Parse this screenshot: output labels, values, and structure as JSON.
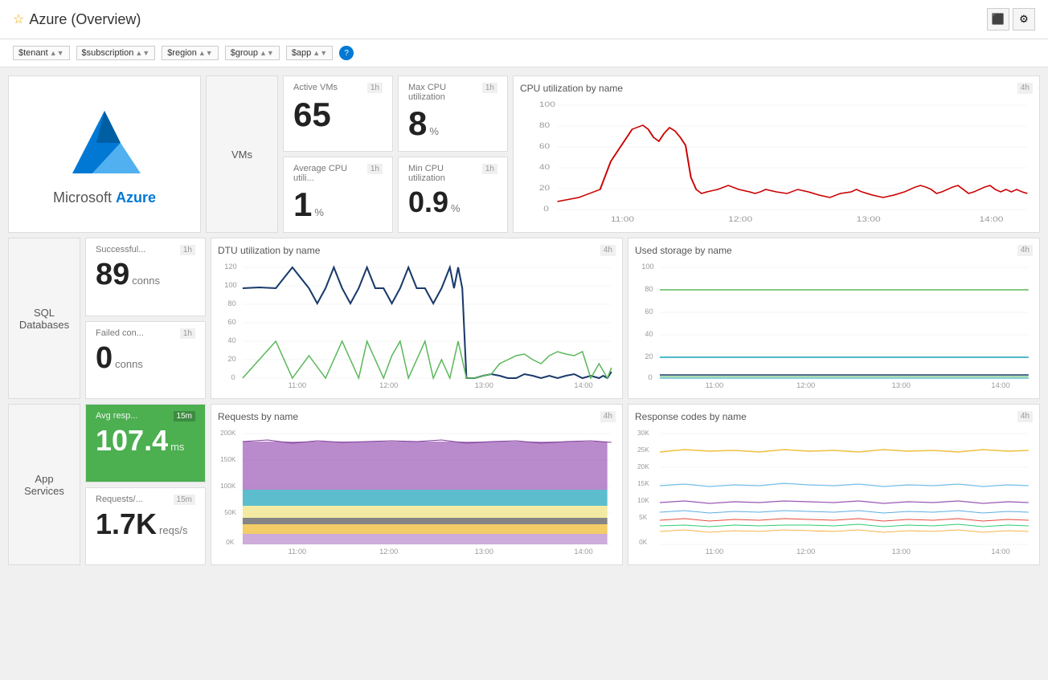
{
  "header": {
    "title": "Azure (Overview)",
    "star": "☆",
    "icons": [
      "monitor",
      "settings"
    ]
  },
  "toolbar": {
    "filters": [
      {
        "label": "$tenant",
        "value": "*"
      },
      {
        "label": "$subscription",
        "value": "*"
      },
      {
        "label": "$region",
        "value": "*"
      },
      {
        "label": "$group",
        "value": "*"
      },
      {
        "label": "$app",
        "value": "*"
      }
    ],
    "help_label": "?"
  },
  "vms": {
    "section_label": "VMs",
    "active_vms": {
      "title": "Active VMs",
      "badge": "1h",
      "value": "65",
      "unit": ""
    },
    "max_cpu": {
      "title": "Max CPU utilization",
      "badge": "1h",
      "value": "8",
      "unit": "%"
    },
    "avg_cpu": {
      "title": "Average CPU utili...",
      "badge": "1h",
      "value": "1",
      "unit": "%"
    },
    "min_cpu": {
      "title": "Min CPU utilization",
      "badge": "1h",
      "value": "0.9",
      "unit": "%"
    },
    "cpu_chart": {
      "title": "CPU utilization by name",
      "badge": "4h",
      "x_labels": [
        "11:00",
        "12:00",
        "13:00",
        "14:00"
      ],
      "y_labels": [
        "100",
        "80",
        "60",
        "40",
        "20",
        "0"
      ]
    }
  },
  "sql": {
    "section_label": "SQL\nDatabases",
    "successful_conns": {
      "title": "Successful...",
      "badge": "1h",
      "value": "89",
      "unit": "conns"
    },
    "failed_conns": {
      "title": "Failed con...",
      "badge": "1h",
      "value": "0",
      "unit": "conns"
    },
    "dtu_chart": {
      "title": "DTU utilization by name",
      "badge": "4h",
      "x_labels": [
        "11:00",
        "12:00",
        "13:00",
        "14:00"
      ],
      "y_labels": [
        "120",
        "100",
        "80",
        "60",
        "40",
        "20",
        "0"
      ]
    },
    "storage_chart": {
      "title": "Used storage by name",
      "badge": "4h",
      "x_labels": [
        "11:00",
        "12:00",
        "13:00",
        "14:00"
      ],
      "y_labels": [
        "100",
        "80",
        "60",
        "40",
        "20",
        "0"
      ]
    }
  },
  "app_services": {
    "section_label": "App\nServices",
    "avg_response": {
      "title": "Avg resp...",
      "badge": "15m",
      "value": "107.4",
      "unit": "ms",
      "green": true
    },
    "requests": {
      "title": "Requests/...",
      "badge": "15m",
      "value": "1.7K",
      "unit": "reqs/s"
    },
    "requests_chart": {
      "title": "Requests by name",
      "badge": "4h",
      "y_labels": [
        "200K",
        "150K",
        "100K",
        "50K",
        "0K"
      ],
      "x_labels": [
        "11:00",
        "12:00",
        "13:00",
        "14:00"
      ]
    },
    "response_codes_chart": {
      "title": "Response codes by name",
      "badge": "4h",
      "y_labels": [
        "30K",
        "25K",
        "20K",
        "15K",
        "10K",
        "5K",
        "0K"
      ],
      "x_labels": [
        "11:00",
        "12:00",
        "13:00",
        "14:00"
      ]
    }
  }
}
